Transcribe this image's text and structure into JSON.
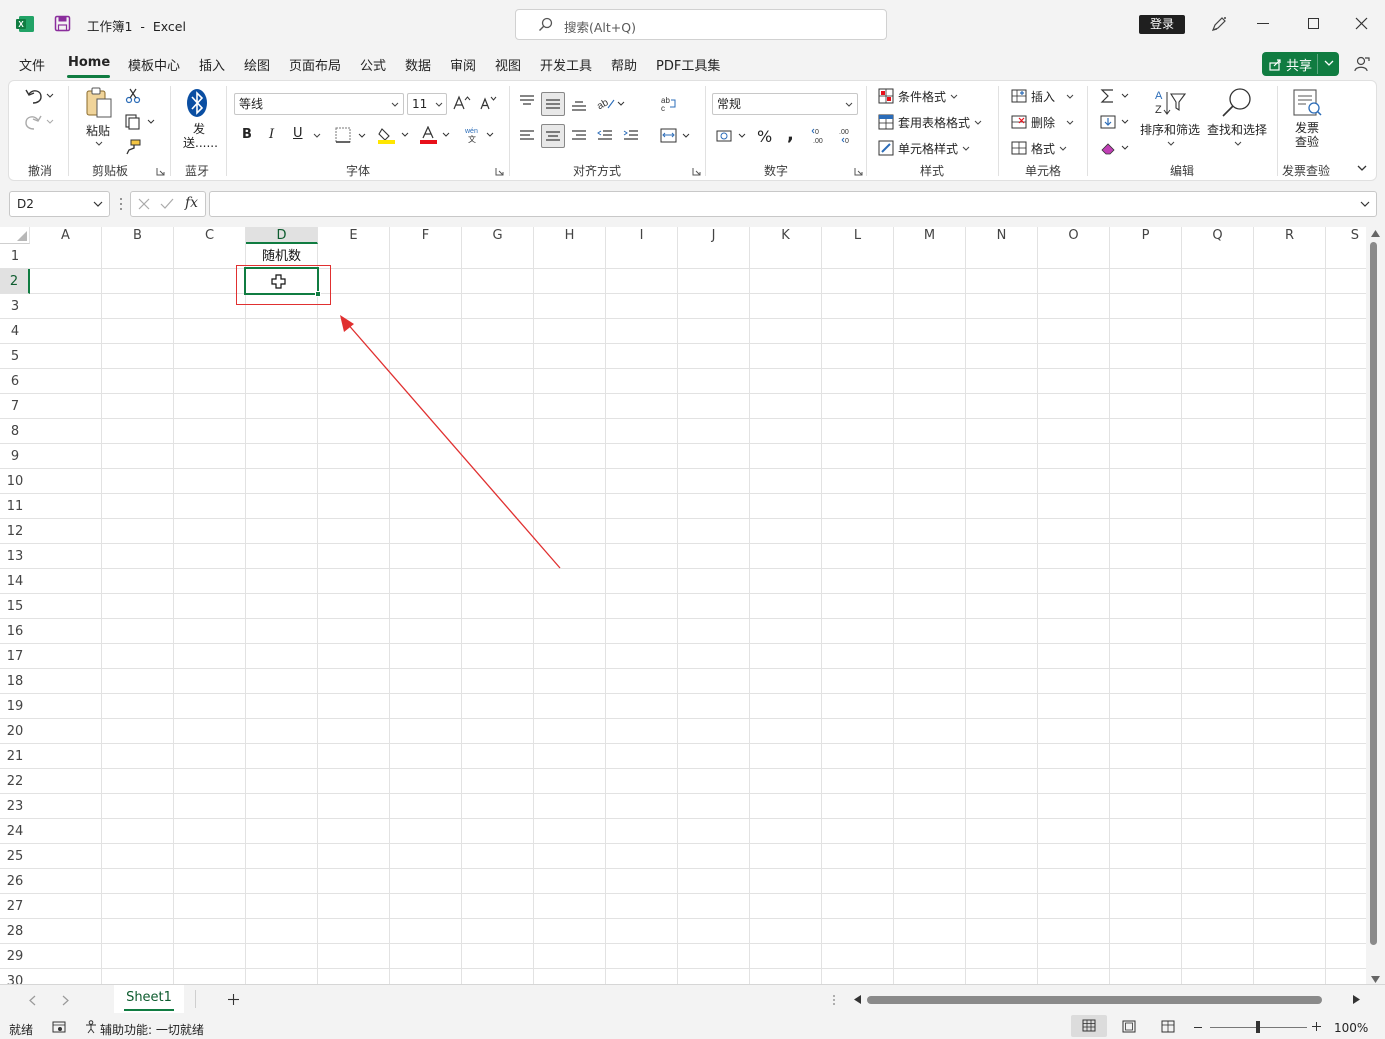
{
  "window": {
    "title": "工作簿1  -  Excel",
    "search_placeholder": "搜索(Alt+Q)",
    "login": "登录"
  },
  "menu": [
    "文件",
    "Home",
    "模板中心",
    "插入",
    "绘图",
    "页面布局",
    "公式",
    "数据",
    "审阅",
    "视图",
    "开发工具",
    "帮助",
    "PDF工具集"
  ],
  "share_label": "共享",
  "ribbon": {
    "groups": {
      "undo": "撤消",
      "clipboard": "剪贴板",
      "bluetooth": "蓝牙",
      "font": "字体",
      "alignment": "对齐方式",
      "number": "数字",
      "styles": "样式",
      "cells": "单元格",
      "editing": "编辑",
      "invoice": "发票查验"
    },
    "paste": "粘贴",
    "send": "发送......",
    "font_name": "等线",
    "font_size": "11",
    "number_format": "常规",
    "conditional_format": "条件格式",
    "table_format": "套用表格格式",
    "cell_styles": "单元格样式",
    "insert": "插入",
    "delete": "删除",
    "format": "格式",
    "sort_filter": "排序和筛选",
    "find_select": "查找和选择",
    "invoice_btn": "发票查验"
  },
  "name_box": "D2",
  "columns": [
    "A",
    "B",
    "C",
    "D",
    "E",
    "F",
    "G",
    "H",
    "I",
    "J",
    "K",
    "L",
    "M",
    "N",
    "O",
    "P",
    "Q",
    "R",
    "S"
  ],
  "rows": [
    "1",
    "2",
    "3",
    "4",
    "5",
    "6",
    "7",
    "8",
    "9",
    "10",
    "11",
    "12",
    "13",
    "14",
    "15",
    "16",
    "17",
    "18",
    "19",
    "20",
    "21",
    "22",
    "23",
    "24",
    "25",
    "26",
    "27",
    "28",
    "29",
    "30"
  ],
  "cells": {
    "D1": "随机数"
  },
  "sheet_tab": "Sheet1",
  "status": {
    "ready": "就绪",
    "accessibility": "辅助功能: 一切就绪",
    "zoom": "100%"
  },
  "colors": {
    "accent": "#107c41",
    "annotation": "#e03030"
  }
}
